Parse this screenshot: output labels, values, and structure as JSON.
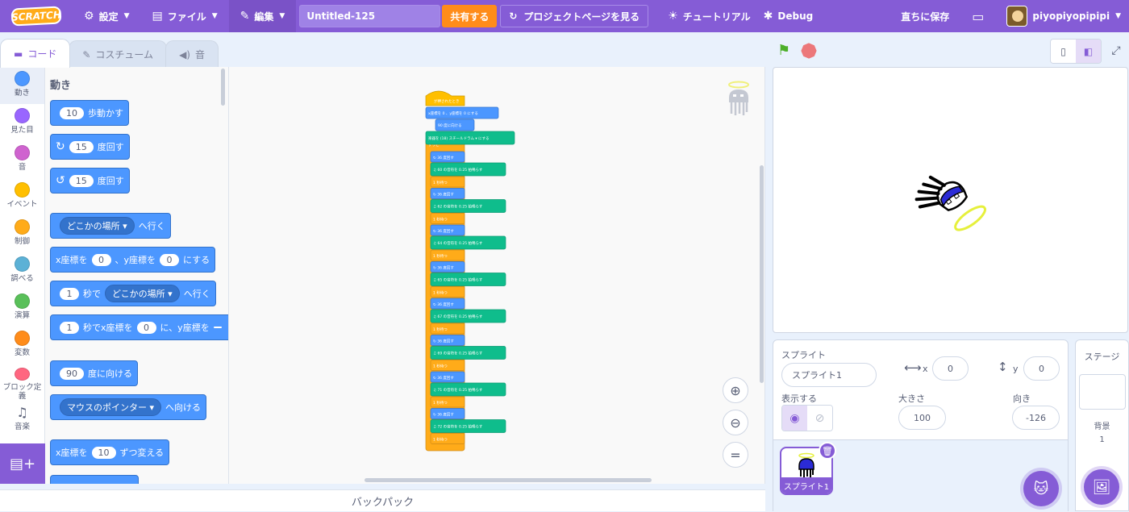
{
  "menubar": {
    "logo": "SCRATCH",
    "settings": "設定",
    "file": "ファイル",
    "edit": "編集",
    "project_title": "Untitled-125",
    "share": "共有する",
    "project_page": "プロジェクトページを見る",
    "tutorials": "チュートリアル",
    "debug": "Debug",
    "save_now": "直ちに保存",
    "username": "piyopiyopipipi"
  },
  "tabs": {
    "code": "コード",
    "costumes": "コスチューム",
    "sounds": "音"
  },
  "categories": [
    {
      "label": "動き",
      "color": "#4c97ff"
    },
    {
      "label": "見た目",
      "color": "#9966ff"
    },
    {
      "label": "音",
      "color": "#cf63cf"
    },
    {
      "label": "イベント",
      "color": "#ffbf00"
    },
    {
      "label": "制御",
      "color": "#ffab19"
    },
    {
      "label": "調べる",
      "color": "#5cb1d6"
    },
    {
      "label": "演算",
      "color": "#59c059"
    },
    {
      "label": "変数",
      "color": "#ff8c1a"
    },
    {
      "label": "ブロック定義",
      "color": "#ff6680"
    },
    {
      "label": "音楽",
      "color": ""
    }
  ],
  "palette": {
    "section": "動き",
    "move": {
      "num": "10",
      "text": "歩動かす"
    },
    "turn_right": {
      "num": "15",
      "text": "度回す"
    },
    "turn_left": {
      "num": "15",
      "text": "度回す"
    },
    "goto": {
      "drop": "どこかの場所",
      "text": "へ行く"
    },
    "goto_xy": {
      "a": "x座標を",
      "x": "0",
      "b": "、y座標を",
      "y": "0",
      "c": "にする"
    },
    "glide": {
      "num": "1",
      "a": "秒で",
      "drop": "どこかの場所",
      "b": "へ行く"
    },
    "glide_xy": {
      "num": "1",
      "a": "秒でx座標を",
      "x": "0",
      "b": "に、y座標を"
    },
    "point": {
      "num": "90",
      "text": "度に向ける"
    },
    "point_towards": {
      "drop": "マウスのポインター",
      "text": "へ向ける"
    },
    "change_x": {
      "a": "x座標を",
      "num": "10",
      "b": "ずつ変える"
    }
  },
  "script": {
    "hat": "が押されたとき",
    "goto_xy": "x座標を 0 、y座標を 0 にする",
    "point": "90 度に向ける",
    "instrument": "楽器を (18) スチールドラム ▾ にする",
    "forever": "ずっと",
    "turn": "度回す",
    "note": "の音符を 0.25 拍鳴らす",
    "wait": "秒待つ",
    "pairs": [
      {
        "turn": "36",
        "note": "60"
      },
      {
        "turn": "36",
        "note": "62"
      },
      {
        "turn": "36",
        "note": "64"
      },
      {
        "turn": "36",
        "note": "65"
      },
      {
        "turn": "36",
        "note": "67"
      },
      {
        "turn": "36",
        "note": "69"
      },
      {
        "turn": "36",
        "note": "71"
      },
      {
        "turn": "36",
        "note": "72"
      }
    ]
  },
  "backpack": "バックパック",
  "sprite_info": {
    "sprite_label": "スプライト",
    "sprite_name": "スプライト1",
    "x_label": "x",
    "x": "0",
    "y_label": "y",
    "y": "0",
    "show_label": "表示する",
    "size_label": "大きさ",
    "size": "100",
    "direction_label": "向き",
    "direction": "-126"
  },
  "sprite_list": [
    {
      "name": "スプライト1"
    }
  ],
  "stage_pane": {
    "title": "ステージ",
    "backdrops_label": "背景",
    "backdrops_count": "1"
  }
}
